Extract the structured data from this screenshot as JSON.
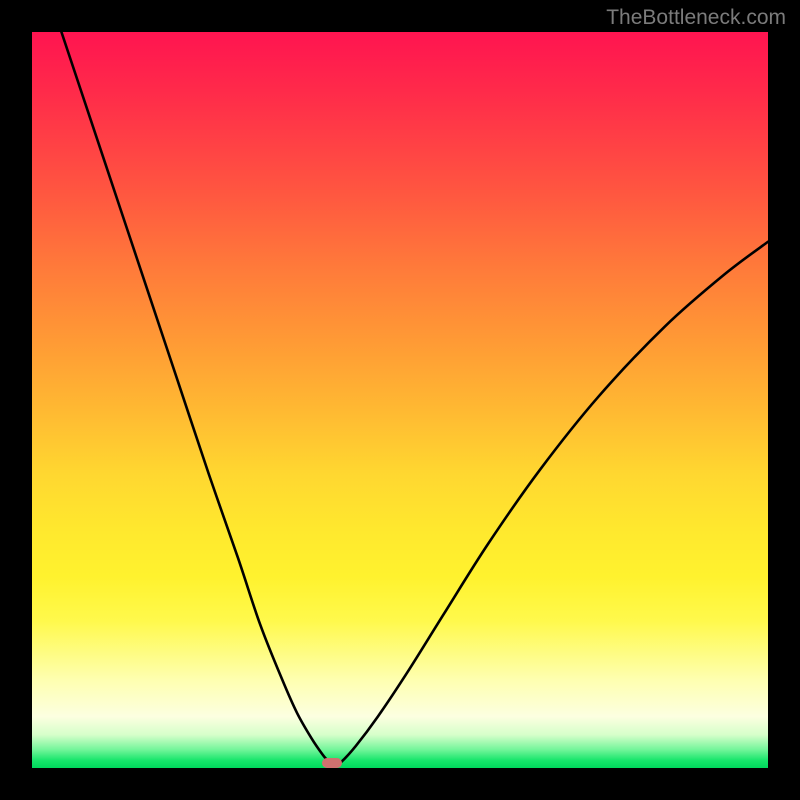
{
  "watermark": "TheBottleneck.com",
  "marker": {
    "x_fraction": 0.408
  },
  "chart_data": {
    "type": "line",
    "title": "",
    "xlabel": "",
    "ylabel": "",
    "xlim": [
      0,
      1
    ],
    "ylim": [
      0,
      1
    ],
    "series": [
      {
        "name": "left-curve",
        "x": [
          0.04,
          0.08,
          0.12,
          0.16,
          0.2,
          0.24,
          0.28,
          0.31,
          0.34,
          0.36,
          0.38,
          0.395,
          0.405
        ],
        "y": [
          1.0,
          0.88,
          0.76,
          0.64,
          0.52,
          0.4,
          0.285,
          0.195,
          0.12,
          0.075,
          0.04,
          0.018,
          0.006
        ]
      },
      {
        "name": "right-curve",
        "x": [
          0.42,
          0.44,
          0.47,
          0.51,
          0.56,
          0.62,
          0.69,
          0.77,
          0.86,
          0.94,
          1.0
        ],
        "y": [
          0.008,
          0.03,
          0.07,
          0.13,
          0.21,
          0.305,
          0.405,
          0.505,
          0.6,
          0.67,
          0.715
        ]
      }
    ],
    "gradient_stops": [
      {
        "pos": 0.0,
        "color": "#ff1450"
      },
      {
        "pos": 0.5,
        "color": "#ffbb32"
      },
      {
        "pos": 0.8,
        "color": "#fff94c"
      },
      {
        "pos": 1.0,
        "color": "#00d85c"
      }
    ]
  }
}
